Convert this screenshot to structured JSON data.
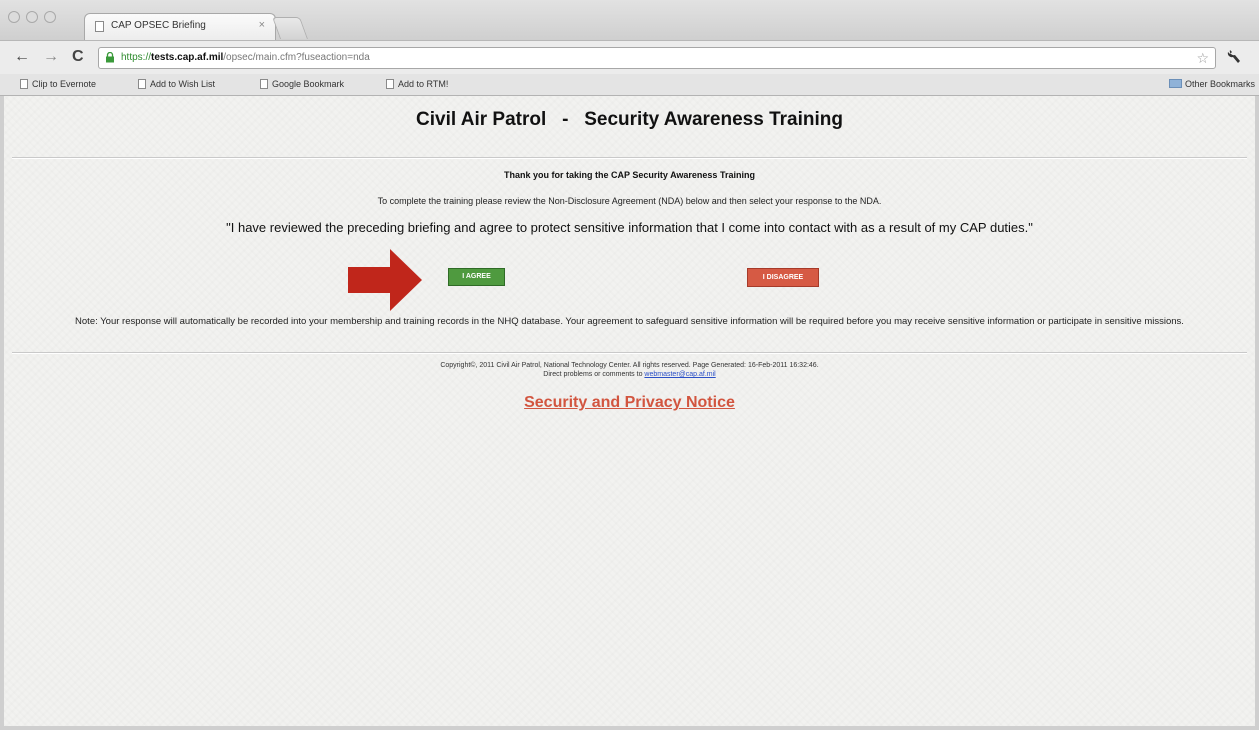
{
  "browser": {
    "tab": {
      "title": "CAP OPSEC Briefing",
      "close_glyph": "×"
    },
    "nav": {
      "back_glyph": "←",
      "forward_glyph": "→",
      "reload_glyph": "C"
    },
    "address_bar": {
      "scheme": "https://",
      "host": "tests.cap.af.mil",
      "path": "/opsec/main.cfm?fuseaction=nda",
      "star_glyph": "☆"
    },
    "wrench_glyph": "🔧",
    "bookmarks": [
      {
        "label": "Clip to Evernote"
      },
      {
        "label": "Add to Wish List"
      },
      {
        "label": "Google Bookmark"
      },
      {
        "label": "Add to RTM!"
      }
    ],
    "other_bookmarks": "Other Bookmarks"
  },
  "page": {
    "title": "Civil Air Patrol   -   Security Awareness Training",
    "thanks": "Thank you for taking the CAP Security Awareness Training",
    "instruction": "To complete the training please review the Non-Disclosure Agreement (NDA) below and then select your response to the NDA.",
    "nda_quote": "\"I have reviewed the preceding briefing and agree to protect sensitive information that I come into contact with as a result of my CAP duties.\"",
    "agree_label": "I AGREE",
    "disagree_label": "I DISAGREE",
    "note": "Note: Your response will automatically be recorded into your membership and training records in the NHQ database. Your agreement to safeguard sensitive information will be required before you may receive sensitive information or participate in sensitive missions.",
    "copyright_line": "Copyright©, 2011 Civil Air Patrol, National Technology Center. All rights reserved. Page Generated: 16-Feb-2011 16:32:46.",
    "contact_prefix": "Direct problems or comments to ",
    "contact_email": "webmaster@cap.af.mil",
    "privacy_link": "Security and Privacy Notice"
  },
  "colors": {
    "agree": "#4f9a3f",
    "disagree": "#d65a44",
    "arrow": "#c0261b",
    "privacy_link": "#d2553f"
  },
  "icons": [
    "page-icon",
    "lock-icon",
    "star-icon",
    "wrench-icon",
    "folder-icon",
    "arrow-right-icon"
  ]
}
